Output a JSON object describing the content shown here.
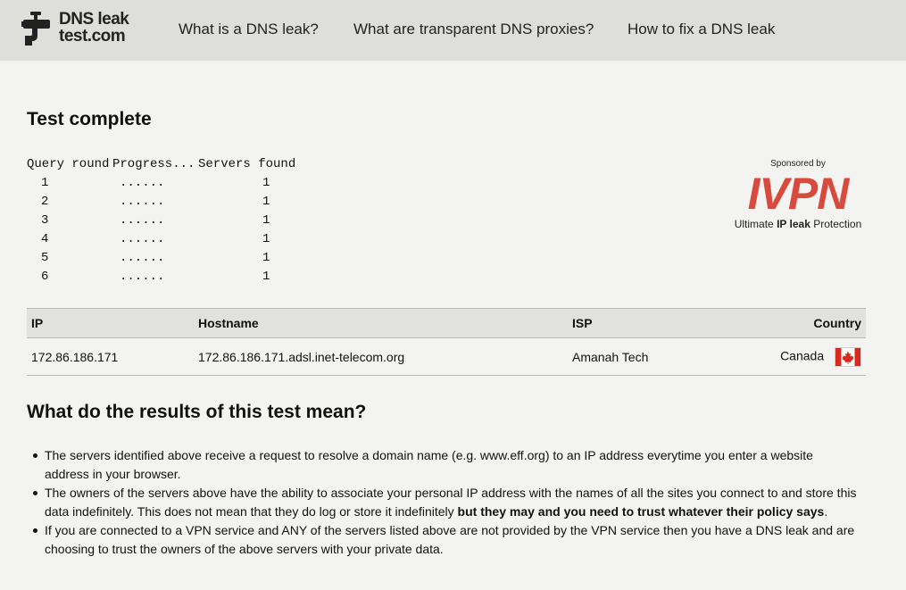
{
  "header": {
    "logo_line1": "DNS leak",
    "logo_line2": "test.com",
    "nav": [
      {
        "label": "What is a DNS leak?"
      },
      {
        "label": "What are transparent DNS proxies?"
      },
      {
        "label": "How to fix a DNS leak"
      }
    ]
  },
  "test": {
    "title": "Test complete",
    "columns": [
      "Query round",
      "Progress...",
      "Servers found"
    ],
    "rounds": [
      {
        "round": "1",
        "progress": "......",
        "servers": "1"
      },
      {
        "round": "2",
        "progress": "......",
        "servers": "1"
      },
      {
        "round": "3",
        "progress": "......",
        "servers": "1"
      },
      {
        "round": "4",
        "progress": "......",
        "servers": "1"
      },
      {
        "round": "5",
        "progress": "......",
        "servers": "1"
      },
      {
        "round": "6",
        "progress": "......",
        "servers": "1"
      }
    ]
  },
  "sponsor": {
    "by": "Sponsored by",
    "brand": "IVPN",
    "tag_prefix": "Ultimate",
    "tag_bold": "IP leak",
    "tag_suffix": "Protection",
    "brand_color": "#d84a3d"
  },
  "results": {
    "headers": {
      "ip": "IP",
      "hostname": "Hostname",
      "isp": "ISP",
      "country": "Country"
    },
    "rows": [
      {
        "ip": "172.86.186.171",
        "hostname": "172.86.186.171.adsl.inet-telecom.org",
        "isp": "Amanah Tech",
        "country": "Canada",
        "flag_icon": "canada-flag-icon"
      }
    ]
  },
  "meaning": {
    "title": "What do the results of this test mean?",
    "items": [
      {
        "text": "The servers identified above receive a request to resolve a domain name (e.g. www.eff.org) to an IP address everytime you enter a website address in your browser."
      },
      {
        "text": "The owners of the servers above have the ability to associate your personal IP address with the names of all the sites you connect to and store this data indefinitely. This does not mean that they do log or store it indefinitely ",
        "bold": "but they may and you need to trust whatever their policy says",
        "after": "."
      },
      {
        "text": "If you are connected to a VPN service and ANY of the servers listed above are not provided by the VPN service then you have a DNS leak and are choosing to trust the owners of the above servers with your private data."
      }
    ]
  }
}
